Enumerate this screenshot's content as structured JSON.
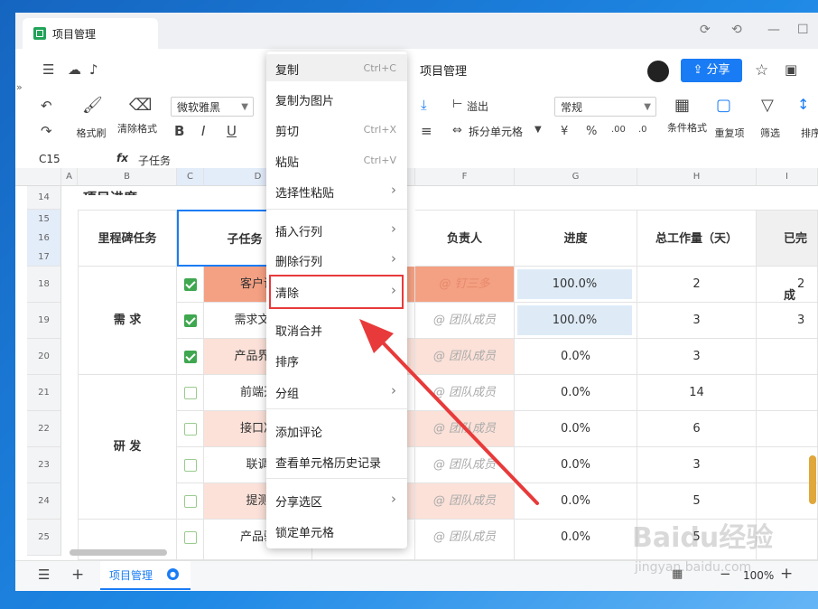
{
  "window": {
    "tab_title": "项目管理",
    "doc_title": "项目管理",
    "share": "分享"
  },
  "ribbon": {
    "format_painter": "格式刷",
    "clear_format": "清除格式",
    "font": "微软雅黑",
    "overflow": "溢出",
    "split_cell": "拆分单元格",
    "number_format": "常规",
    "conditional_format": "条件格式",
    "duplicates": "重复项",
    "filter": "筛选",
    "sort": "排序"
  },
  "formula_bar": {
    "cell_ref": "C15",
    "fx": "fx",
    "value": "子任务"
  },
  "columns": [
    "A",
    "B",
    "C",
    "D",
    "E",
    "F",
    "G",
    "H",
    "I"
  ],
  "rows": [
    "14",
    "15",
    "16",
    "17",
    "18",
    "19",
    "20",
    "21",
    "22",
    "23",
    "24",
    "25"
  ],
  "section_title": "项目进度",
  "headers": {
    "milestone": "里程碑任务",
    "subtask": "子任务",
    "owner": "负责人",
    "progress": "进度",
    "total_work": "总工作量（天）",
    "done": "已完成"
  },
  "groups": [
    "需 求",
    "研 发"
  ],
  "table_rows": [
    {
      "subtask": "客户调",
      "owner": "@ 钉三多",
      "progress": "100.0%",
      "work": "2",
      "done": "2"
    },
    {
      "subtask": "需求文档",
      "owner": "@ 团队成员",
      "progress": "100.0%",
      "work": "3",
      "done": "3"
    },
    {
      "subtask": "产品界面",
      "owner": "@ 团队成员",
      "progress": "0.0%",
      "work": "3",
      "done": ""
    },
    {
      "subtask": "前端开",
      "owner": "@ 团队成员",
      "progress": "0.0%",
      "work": "14",
      "done": ""
    },
    {
      "subtask": "接口准",
      "owner": "@ 团队成员",
      "progress": "0.0%",
      "work": "6",
      "done": ""
    },
    {
      "subtask": "联调",
      "owner": "@ 团队成员",
      "progress": "0.0%",
      "work": "3",
      "done": ""
    },
    {
      "subtask": "提测",
      "owner": "@ 团队成员",
      "progress": "0.0%",
      "work": "5",
      "done": ""
    },
    {
      "subtask": "产品验",
      "owner": "@ 团队成员",
      "progress": "0.0%",
      "work": "5",
      "done": ""
    }
  ],
  "context_menu": {
    "copy": "复制",
    "copy_sc": "Ctrl+C",
    "copy_image": "复制为图片",
    "cut": "剪切",
    "cut_sc": "Ctrl+X",
    "paste": "粘贴",
    "paste_sc": "Ctrl+V",
    "paste_special": "选择性粘贴",
    "insert_row_col": "插入行列",
    "delete_row_col": "删除行列",
    "clear": "清除",
    "unmerge": "取消合并",
    "sort": "排序",
    "group": "分组",
    "add_comment": "添加评论",
    "cell_history": "查看单元格历史记录",
    "share_selection": "分享选区",
    "lock_cell": "锁定单元格"
  },
  "bottom": {
    "sheet_tab": "项目管理",
    "zoom": "100%"
  },
  "watermark": {
    "brand": "Baidu经验",
    "url": "jingyan.baidu.com"
  },
  "colors": {
    "accent": "#1a7cf5",
    "highlight_red": "#e83a3a",
    "cell_orange": "#f4a083",
    "cell_pink": "#fbe1d8",
    "check_green": "#3fa74f"
  }
}
